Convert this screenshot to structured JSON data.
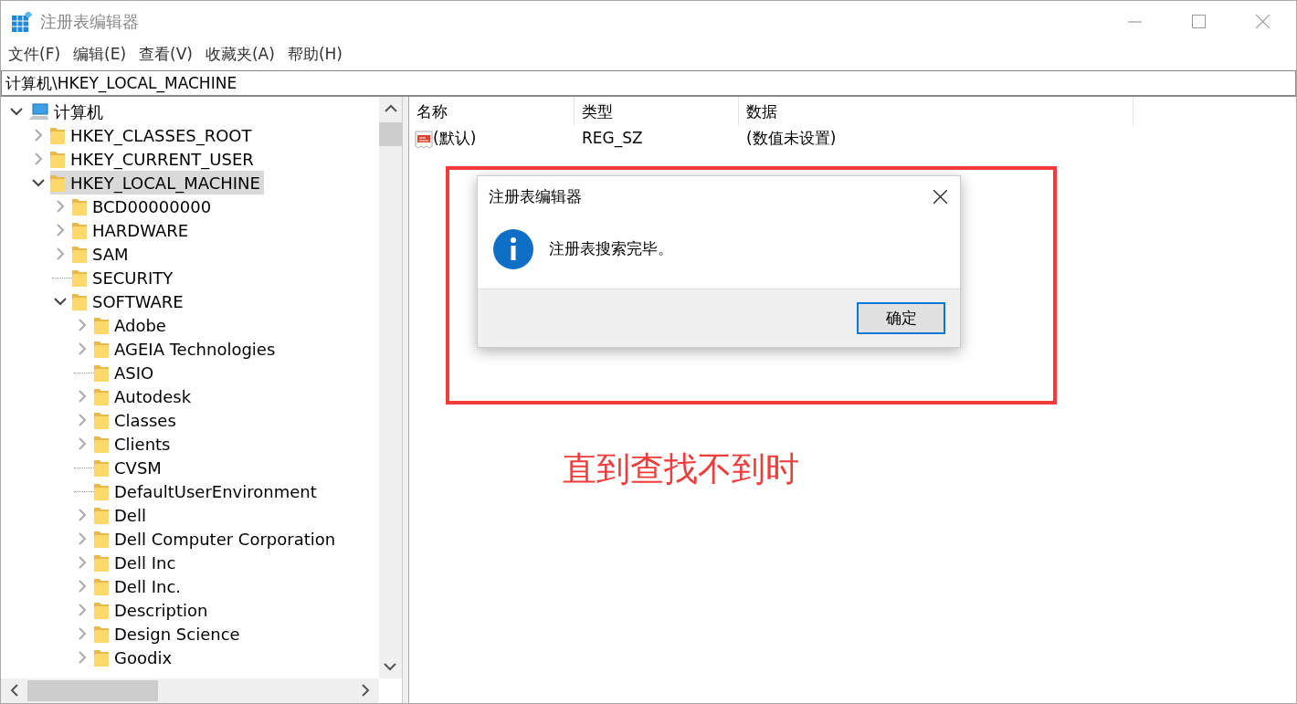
{
  "window": {
    "title": "注册表编辑器"
  },
  "menu": [
    "文件(F)",
    "编辑(E)",
    "查看(V)",
    "收藏夹(A)",
    "帮助(H)"
  ],
  "address": "计算机\\HKEY_LOCAL_MACHINE",
  "tree": [
    {
      "label": "计算机",
      "kind": "computer",
      "expanded": true,
      "selected": false,
      "children": [
        {
          "label": "HKEY_CLASSES_ROOT",
          "kind": "folder",
          "expanded": false,
          "selected": false
        },
        {
          "label": "HKEY_CURRENT_USER",
          "kind": "folder",
          "expanded": false,
          "selected": false
        },
        {
          "label": "HKEY_LOCAL_MACHINE",
          "kind": "folder",
          "expanded": true,
          "selected": true,
          "children": [
            {
              "label": "BCD00000000",
              "kind": "folder",
              "expanded": false,
              "selected": false
            },
            {
              "label": "HARDWARE",
              "kind": "folder",
              "expanded": false,
              "selected": false
            },
            {
              "label": "SAM",
              "kind": "folder",
              "expanded": false,
              "selected": false
            },
            {
              "label": "SECURITY",
              "kind": "leaf",
              "selected": false
            },
            {
              "label": "SOFTWARE",
              "kind": "folder",
              "expanded": true,
              "selected": false,
              "children": [
                {
                  "label": "Adobe",
                  "kind": "folder",
                  "expanded": false,
                  "selected": false
                },
                {
                  "label": "AGEIA Technologies",
                  "kind": "folder",
                  "expanded": false,
                  "selected": false
                },
                {
                  "label": "ASIO",
                  "kind": "leaf",
                  "selected": false
                },
                {
                  "label": "Autodesk",
                  "kind": "folder",
                  "expanded": false,
                  "selected": false
                },
                {
                  "label": "Classes",
                  "kind": "folder",
                  "expanded": false,
                  "selected": false
                },
                {
                  "label": "Clients",
                  "kind": "folder",
                  "expanded": false,
                  "selected": false
                },
                {
                  "label": "CVSM",
                  "kind": "leaf",
                  "selected": false
                },
                {
                  "label": "DefaultUserEnvironment",
                  "kind": "leaf",
                  "selected": false
                },
                {
                  "label": "Dell",
                  "kind": "folder",
                  "expanded": false,
                  "selected": false
                },
                {
                  "label": "Dell Computer Corporation",
                  "kind": "folder",
                  "expanded": false,
                  "selected": false
                },
                {
                  "label": "Dell Inc",
                  "kind": "folder",
                  "expanded": false,
                  "selected": false
                },
                {
                  "label": "Dell Inc.",
                  "kind": "folder",
                  "expanded": false,
                  "selected": false
                },
                {
                  "label": "Description",
                  "kind": "folder",
                  "expanded": false,
                  "selected": false
                },
                {
                  "label": "Design Science",
                  "kind": "folder",
                  "expanded": false,
                  "selected": false
                },
                {
                  "label": "Goodix",
                  "kind": "folder",
                  "expanded": false,
                  "selected": false
                }
              ]
            }
          ]
        }
      ]
    }
  ],
  "table": {
    "columns": [
      "名称",
      "类型",
      "数据"
    ],
    "rows": [
      {
        "name": "(默认)",
        "type": "REG_SZ",
        "data": "(数值未设置)"
      }
    ]
  },
  "dialog": {
    "title": "注册表编辑器",
    "message": "注册表搜索完毕。",
    "button": "确定"
  },
  "annotation": {
    "text": "直到查找不到时"
  }
}
